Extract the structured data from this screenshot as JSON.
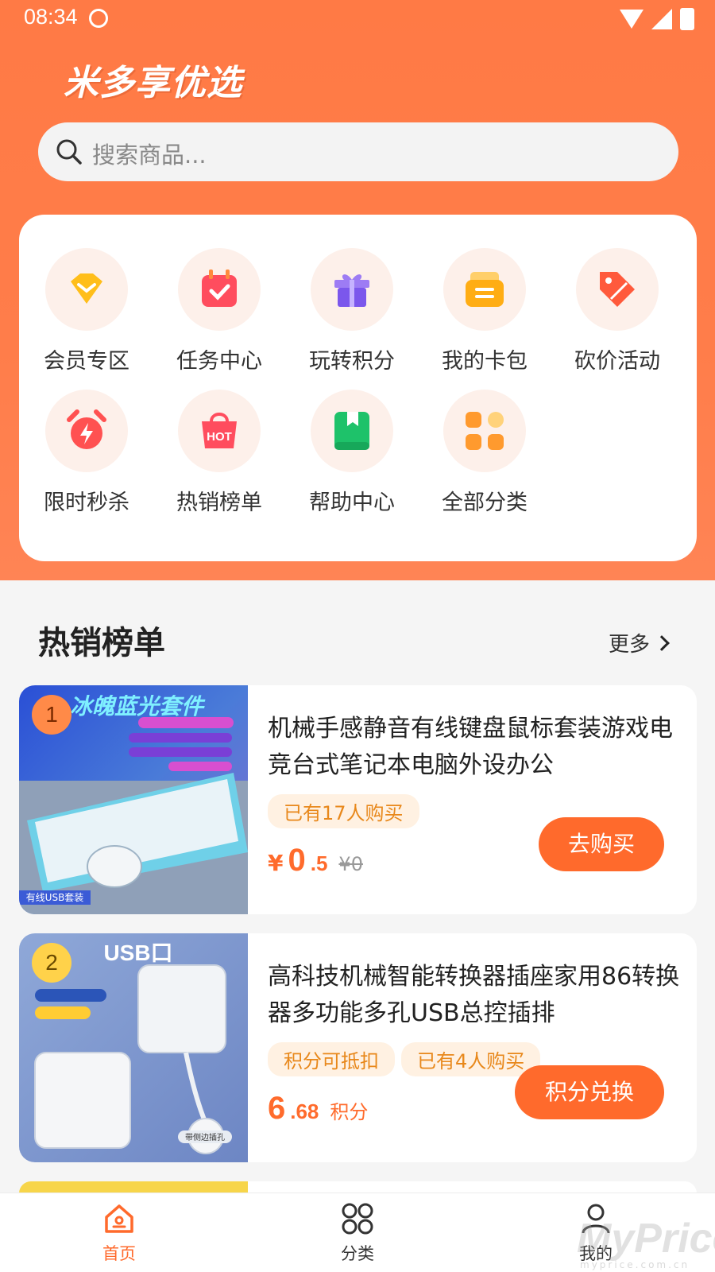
{
  "status": {
    "time": "08:34"
  },
  "brand": "米多享优选",
  "search": {
    "placeholder": "搜索商品..."
  },
  "menu": [
    {
      "label": "会员专区",
      "icon": "diamond-icon"
    },
    {
      "label": "任务中心",
      "icon": "calendar-check-icon"
    },
    {
      "label": "玩转积分",
      "icon": "gift-icon"
    },
    {
      "label": "我的卡包",
      "icon": "card-wallet-icon"
    },
    {
      "label": "砍价活动",
      "icon": "price-tag-icon"
    },
    {
      "label": "限时秒杀",
      "icon": "alarm-clock-icon"
    },
    {
      "label": "热销榜单",
      "icon": "hot-bag-icon"
    },
    {
      "label": "帮助中心",
      "icon": "bookmark-book-icon"
    },
    {
      "label": "全部分类",
      "icon": "category-grid-icon"
    }
  ],
  "hot_section": {
    "title": "热销榜单",
    "more": "更多"
  },
  "products": [
    {
      "rank": "1",
      "image_text": "冰魄蓝光套件",
      "image_badge": "有线USB套装",
      "title": "机械手感静音有线键盘鼠标套装游戏电竞台式笔记本电脑外设办公",
      "tags": [
        "已有17人购买"
      ],
      "price_symbol": "¥",
      "price_int": "0",
      "price_dec": ".5",
      "price_original": "¥0",
      "button": "去购买"
    },
    {
      "rank": "2",
      "image_text": "USB口",
      "image_badge": "带侧边插孔",
      "title": "高科技机械智能转换器插座家用86转换器多功能多孔USB总控插排",
      "tags": [
        "积分可抵扣",
        "已有4人购买"
      ],
      "price_int": "6",
      "price_dec": ".68",
      "price_unit": "积分",
      "button": "积分兑换"
    }
  ],
  "tabbar": [
    {
      "label": "首页",
      "icon": "home-icon",
      "active": true
    },
    {
      "label": "分类",
      "icon": "grid-icon",
      "active": false
    },
    {
      "label": "我的",
      "icon": "user-icon",
      "active": false
    }
  ],
  "watermark": {
    "text": "MyPrice",
    "sub": "myprice.com.cn"
  },
  "colors": {
    "primary": "#ff6a2c",
    "header": "#ff7a45",
    "tag_bg": "#fff1e2",
    "tag_text": "#e8881b"
  }
}
